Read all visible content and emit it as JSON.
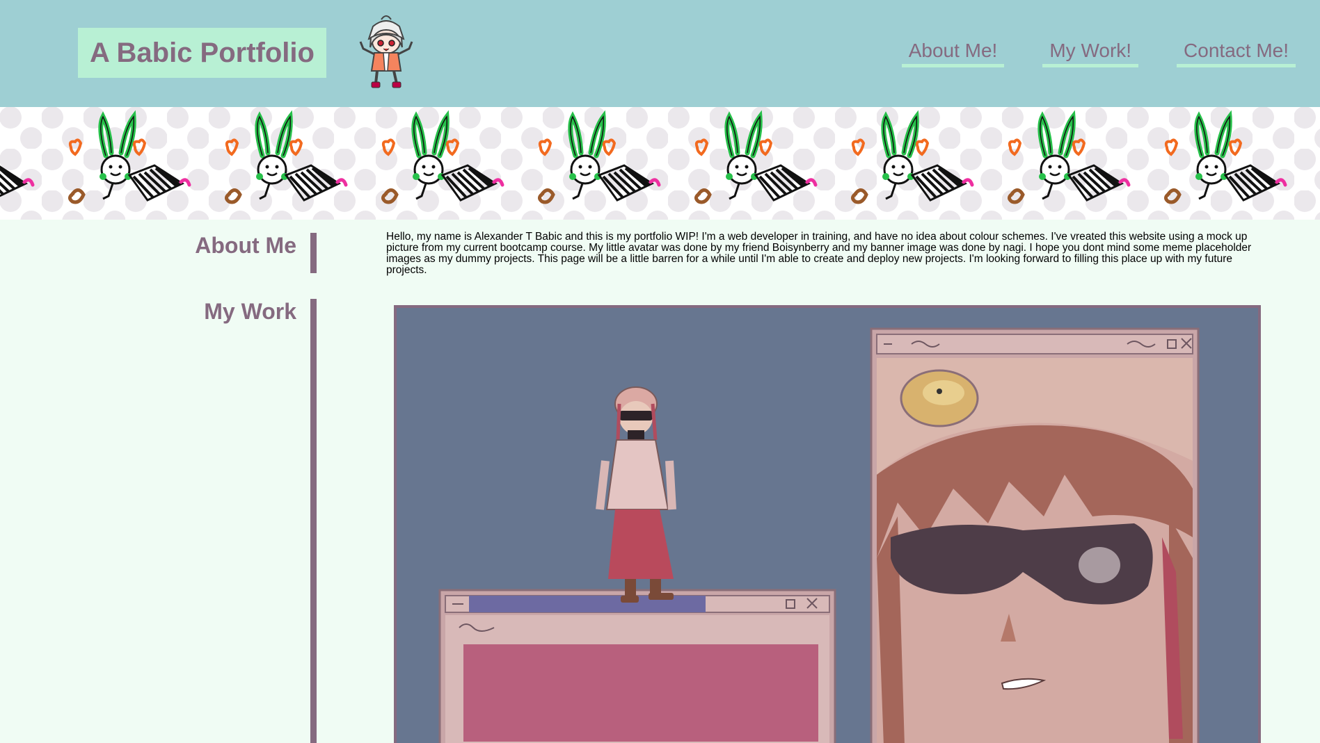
{
  "header": {
    "title": "A Babic Portfolio",
    "nav": [
      {
        "label": "About Me!"
      },
      {
        "label": "My Work!"
      },
      {
        "label": "Contact Me!"
      }
    ]
  },
  "sidebar": {
    "items": [
      {
        "label": "About Me"
      },
      {
        "label": "My Work"
      }
    ]
  },
  "about": {
    "text": "Hello, my name is Alexander T Babic and this is my portfolio WIP! I'm a web developer in training, and have no idea about colour schemes. I've vreated this website using a mock up picture from my current bootcamp course. My little avatar was done by my friend Boisynberry and my banner image was done by nagi. I hope you dont mind some meme placeholder images as my dummy projects. This page will be a little barren for a while until I'm able to create and deploy new projects. I'm looking forward to filling this place up with my future projects."
  },
  "colors": {
    "header_bg": "#9ecfd3",
    "accent_mint": "#b8f0d4",
    "accent_mauve": "#856a80",
    "page_bg": "#f0fcf4"
  },
  "icons": {
    "avatar": "chibi-avatar-icon",
    "banner": "bunny-doodle-banner"
  }
}
